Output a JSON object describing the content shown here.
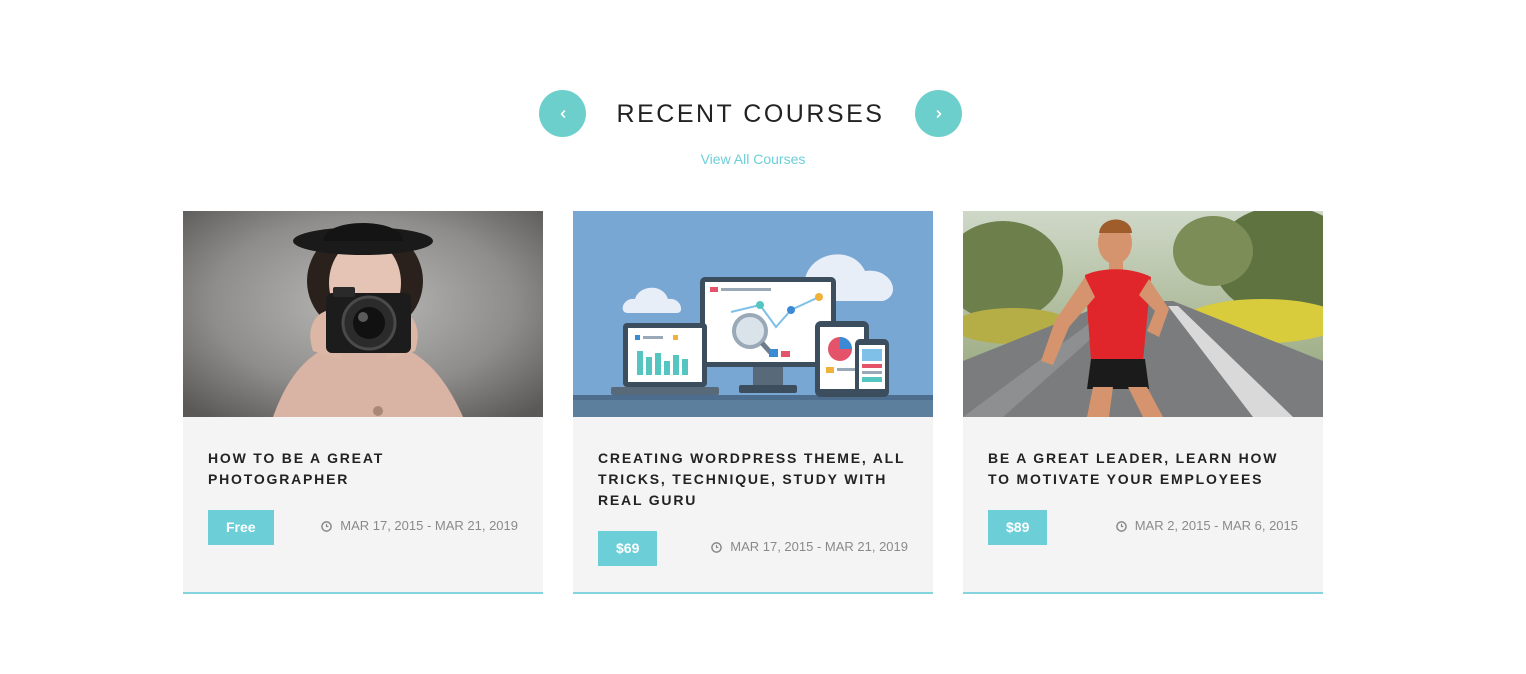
{
  "section": {
    "title": "RECENT COURSES",
    "view_all_label": "View All Courses",
    "accent_color": "#6ccfcb"
  },
  "nav": {
    "prev_icon": "chevron-left-icon",
    "next_icon": "chevron-right-icon"
  },
  "courses": [
    {
      "title": "HOW TO BE A GREAT PHOTOGRAPHER",
      "price": "Free",
      "date": "MAR 17, 2015 - MAR 21, 2019",
      "image": "woman-with-camera-photo"
    },
    {
      "title": "CREATING WORDPRESS THEME, ALL TRICKS, TECHNIQUE, STUDY WITH REAL GURU",
      "price": "$69",
      "date": "MAR 17, 2015 - MAR 21, 2019",
      "image": "devices-analytics-illustration"
    },
    {
      "title": "BE A GREAT LEADER, LEARN HOW TO MOTIVATE YOUR EMPLOYEES",
      "price": "$89",
      "date": "MAR 2, 2015 - MAR 6, 2015",
      "image": "runner-on-road-photo"
    }
  ]
}
